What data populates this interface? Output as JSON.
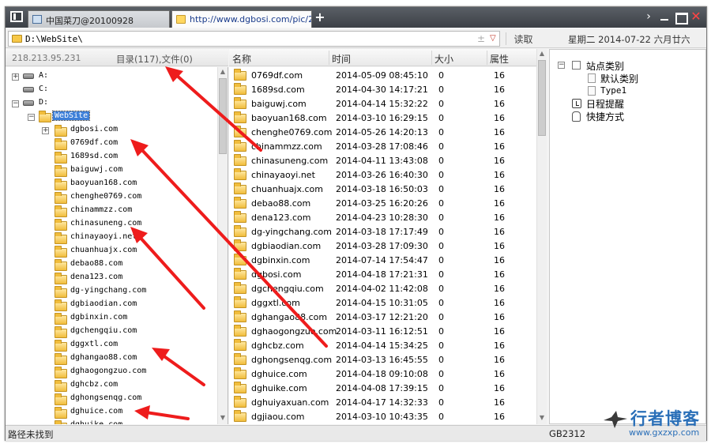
{
  "tabs": [
    {
      "label": "中国菜刀@20100928",
      "active": false
    },
    {
      "label": "http://www.dgbosi.com/pic/2...",
      "active": true
    }
  ],
  "window_controls": {
    "new_tab": "+",
    "more": "›",
    "close": "✕"
  },
  "address": {
    "path": "D:\\WebSite\\",
    "star": "±",
    "dropdown": "▽",
    "read_button": "读取"
  },
  "date_display": "星期二 2014-07-22 六月廿六",
  "left_panel": {
    "ip": "218.213.95.231",
    "counts": "目录(117),文件(0)",
    "drives": [
      {
        "label": "A:",
        "expander": "+"
      },
      {
        "label": "C:",
        "expander": ""
      },
      {
        "label": "D:",
        "expander": "−"
      }
    ],
    "selected_folder": "WebSite",
    "selected_expander": "−",
    "folders": [
      {
        "label": "dgbosi.com",
        "expander": "+"
      },
      {
        "label": "0769df.com"
      },
      {
        "label": "1689sd.com"
      },
      {
        "label": "baiguwj.com"
      },
      {
        "label": "baoyuan168.com"
      },
      {
        "label": "chenghe0769.com"
      },
      {
        "label": "chinammzz.com"
      },
      {
        "label": "chinasuneng.com"
      },
      {
        "label": "chinayaoyi.net"
      },
      {
        "label": "chuanhuajx.com"
      },
      {
        "label": "debao88.com"
      },
      {
        "label": "dena123.com"
      },
      {
        "label": "dg-yingchang.com"
      },
      {
        "label": "dgbiaodian.com"
      },
      {
        "label": "dgbinxin.com"
      },
      {
        "label": "dgchengqiu.com"
      },
      {
        "label": "dggxtl.com"
      },
      {
        "label": "dghangao88.com"
      },
      {
        "label": "dghaogongzuo.com"
      },
      {
        "label": "dghcbz.com"
      },
      {
        "label": "dghongsenqg.com"
      },
      {
        "label": "dghuice.com"
      },
      {
        "label": "dghuike.com"
      }
    ]
  },
  "file_list": {
    "columns": [
      "名称",
      "时间",
      "大小",
      "属性"
    ],
    "rows": [
      [
        "0769df.com",
        "2014-05-09 08:45:10",
        "0",
        "16"
      ],
      [
        "1689sd.com",
        "2014-04-30 14:17:21",
        "0",
        "16"
      ],
      [
        "baiguwj.com",
        "2014-04-14 15:32:22",
        "0",
        "16"
      ],
      [
        "baoyuan168.com",
        "2014-03-10 16:29:15",
        "0",
        "16"
      ],
      [
        "chenghe0769.com",
        "2014-05-26 14:20:13",
        "0",
        "16"
      ],
      [
        "chinammzz.com",
        "2014-03-28 17:08:46",
        "0",
        "16"
      ],
      [
        "chinasuneng.com",
        "2014-04-11 13:43:08",
        "0",
        "16"
      ],
      [
        "chinayaoyi.net",
        "2014-03-26 16:40:30",
        "0",
        "16"
      ],
      [
        "chuanhuajx.com",
        "2014-03-18 16:50:03",
        "0",
        "16"
      ],
      [
        "debao88.com",
        "2014-03-25 16:20:26",
        "0",
        "16"
      ],
      [
        "dena123.com",
        "2014-04-23 10:28:30",
        "0",
        "16"
      ],
      [
        "dg-yingchang.com",
        "2014-03-18 17:17:49",
        "0",
        "16"
      ],
      [
        "dgbiaodian.com",
        "2014-03-28 17:09:30",
        "0",
        "16"
      ],
      [
        "dgbinxin.com",
        "2014-07-14 17:54:47",
        "0",
        "16"
      ],
      [
        "dgbosi.com",
        "2014-04-18 17:21:31",
        "0",
        "16"
      ],
      [
        "dgchengqiu.com",
        "2014-04-02 11:42:08",
        "0",
        "16"
      ],
      [
        "dggxtl.com",
        "2014-04-15 10:31:05",
        "0",
        "16"
      ],
      [
        "dghangao88.com",
        "2014-03-17 12:21:20",
        "0",
        "16"
      ],
      [
        "dghaogongzuo.com",
        "2014-03-11 16:12:51",
        "0",
        "16"
      ],
      [
        "dghcbz.com",
        "2014-04-14 15:34:25",
        "0",
        "16"
      ],
      [
        "dghongsenqg.com",
        "2014-03-13 16:45:55",
        "0",
        "16"
      ],
      [
        "dghuice.com",
        "2014-04-18 09:10:08",
        "0",
        "16"
      ],
      [
        "dghuike.com",
        "2014-04-08 17:39:15",
        "0",
        "16"
      ],
      [
        "dghuiyaxuan.com",
        "2014-04-17 14:32:33",
        "0",
        "16"
      ],
      [
        "dgjiaou.com",
        "2014-03-10 10:43:35",
        "0",
        "16"
      ]
    ]
  },
  "right_panel": {
    "site_category": "站点类别",
    "site_category_expander": "−",
    "categories": [
      "默认类别",
      "Type1"
    ],
    "reminder": "日程提醒",
    "shortcuts": "快捷方式"
  },
  "status": {
    "message": "路径未找到",
    "encoding": "GB2312"
  },
  "watermark": {
    "title": "行者博客",
    "url": "www.gxzxp.com"
  },
  "colors": {
    "arrow": "#ee1c1c",
    "selection": "#3d7fd8",
    "folder": "#f1bd3c",
    "watermark": "#2a6fb8"
  }
}
